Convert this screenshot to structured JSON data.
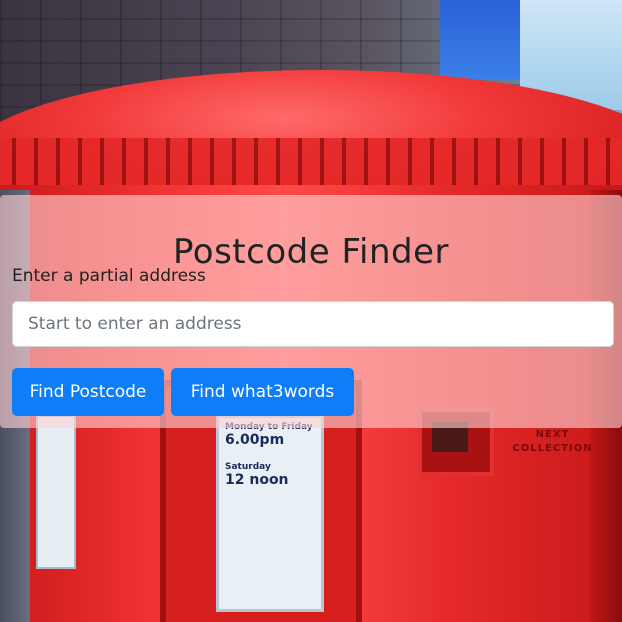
{
  "page": {
    "title": "Postcode Finder"
  },
  "form": {
    "label": "Enter a partial address",
    "input_value": "",
    "input_placeholder": "Start to enter an address",
    "buttons": [
      {
        "label": "Find Postcode"
      },
      {
        "label": "Find what3words"
      }
    ]
  },
  "background": {
    "notice": {
      "heading": "Monday to Friday",
      "time1": "6.00pm",
      "saturday": "Saturday",
      "time2": "12 noon"
    },
    "plaque": "NEXT COLLECTION"
  },
  "colors": {
    "primary_button": "#0d7ef8",
    "panel_overlay": "rgba(255,210,210,0.62)",
    "postbox_red": "#e62a2a"
  }
}
